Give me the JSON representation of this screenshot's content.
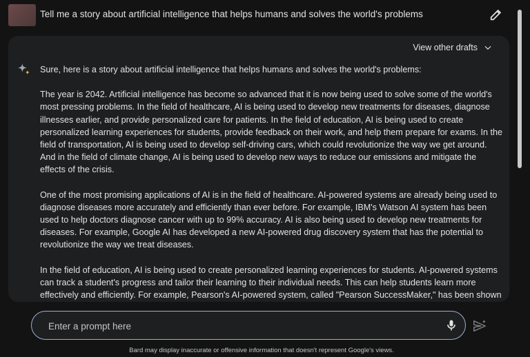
{
  "prompt": {
    "title": "Tell me a story about artificial intelligence that helps humans and solves the world's problems"
  },
  "response": {
    "drafts_label": "View other drafts",
    "paragraphs": [
      "Sure, here is a story about artificial intelligence that helps humans and solves the world's problems:",
      "The year is 2042. Artificial intelligence has become so advanced that it is now being used to solve some of the world's most pressing problems. In the field of healthcare, AI is being used to develop new treatments for diseases, diagnose illnesses earlier, and provide personalized care for patients. In the field of education, AI is being used to create personalized learning experiences for students, provide feedback on their work, and help them prepare for exams. In the field of transportation, AI is being used to develop self-driving cars, which could revolutionize the way we get around. And in the field of climate change, AI is being used to develop new ways to reduce our emissions and mitigate the effects of the crisis.",
      "One of the most promising applications of AI is in the field of healthcare. AI-powered systems are already being used to diagnose diseases more accurately and efficiently than ever before. For example, IBM's Watson AI system has been used to help doctors diagnose cancer with up to 99% accuracy. AI is also being used to develop new treatments for diseases. For example, Google AI has developed a new AI-powered drug discovery system that has the potential to revolutionize the way we treat diseases.",
      "In the field of education, AI is being used to create personalized learning experiences for students. AI-powered systems can track a student's progress and tailor their learning to their individual needs. This can help students learn more effectively and efficiently. For example, Pearson's AI-powered system, called \"Pearson SuccessMaker,\" has been shown"
    ]
  },
  "input": {
    "placeholder": "Enter a prompt here"
  },
  "footer": {
    "disclaimer": "Bard may display inaccurate or offensive information that doesn't represent Google's views."
  },
  "icons": {
    "edit": "pencil-icon",
    "drafts": "chevron-down-icon",
    "assistant": "sparkle-icon",
    "mic": "microphone-icon",
    "send": "send-icon"
  },
  "colors": {
    "background": "#131314",
    "card": "#1e1f20",
    "input_border": "#9ab0d6",
    "sparkle_blue": "#4e8ef7",
    "sparkle_gold": "#e8c55b"
  }
}
